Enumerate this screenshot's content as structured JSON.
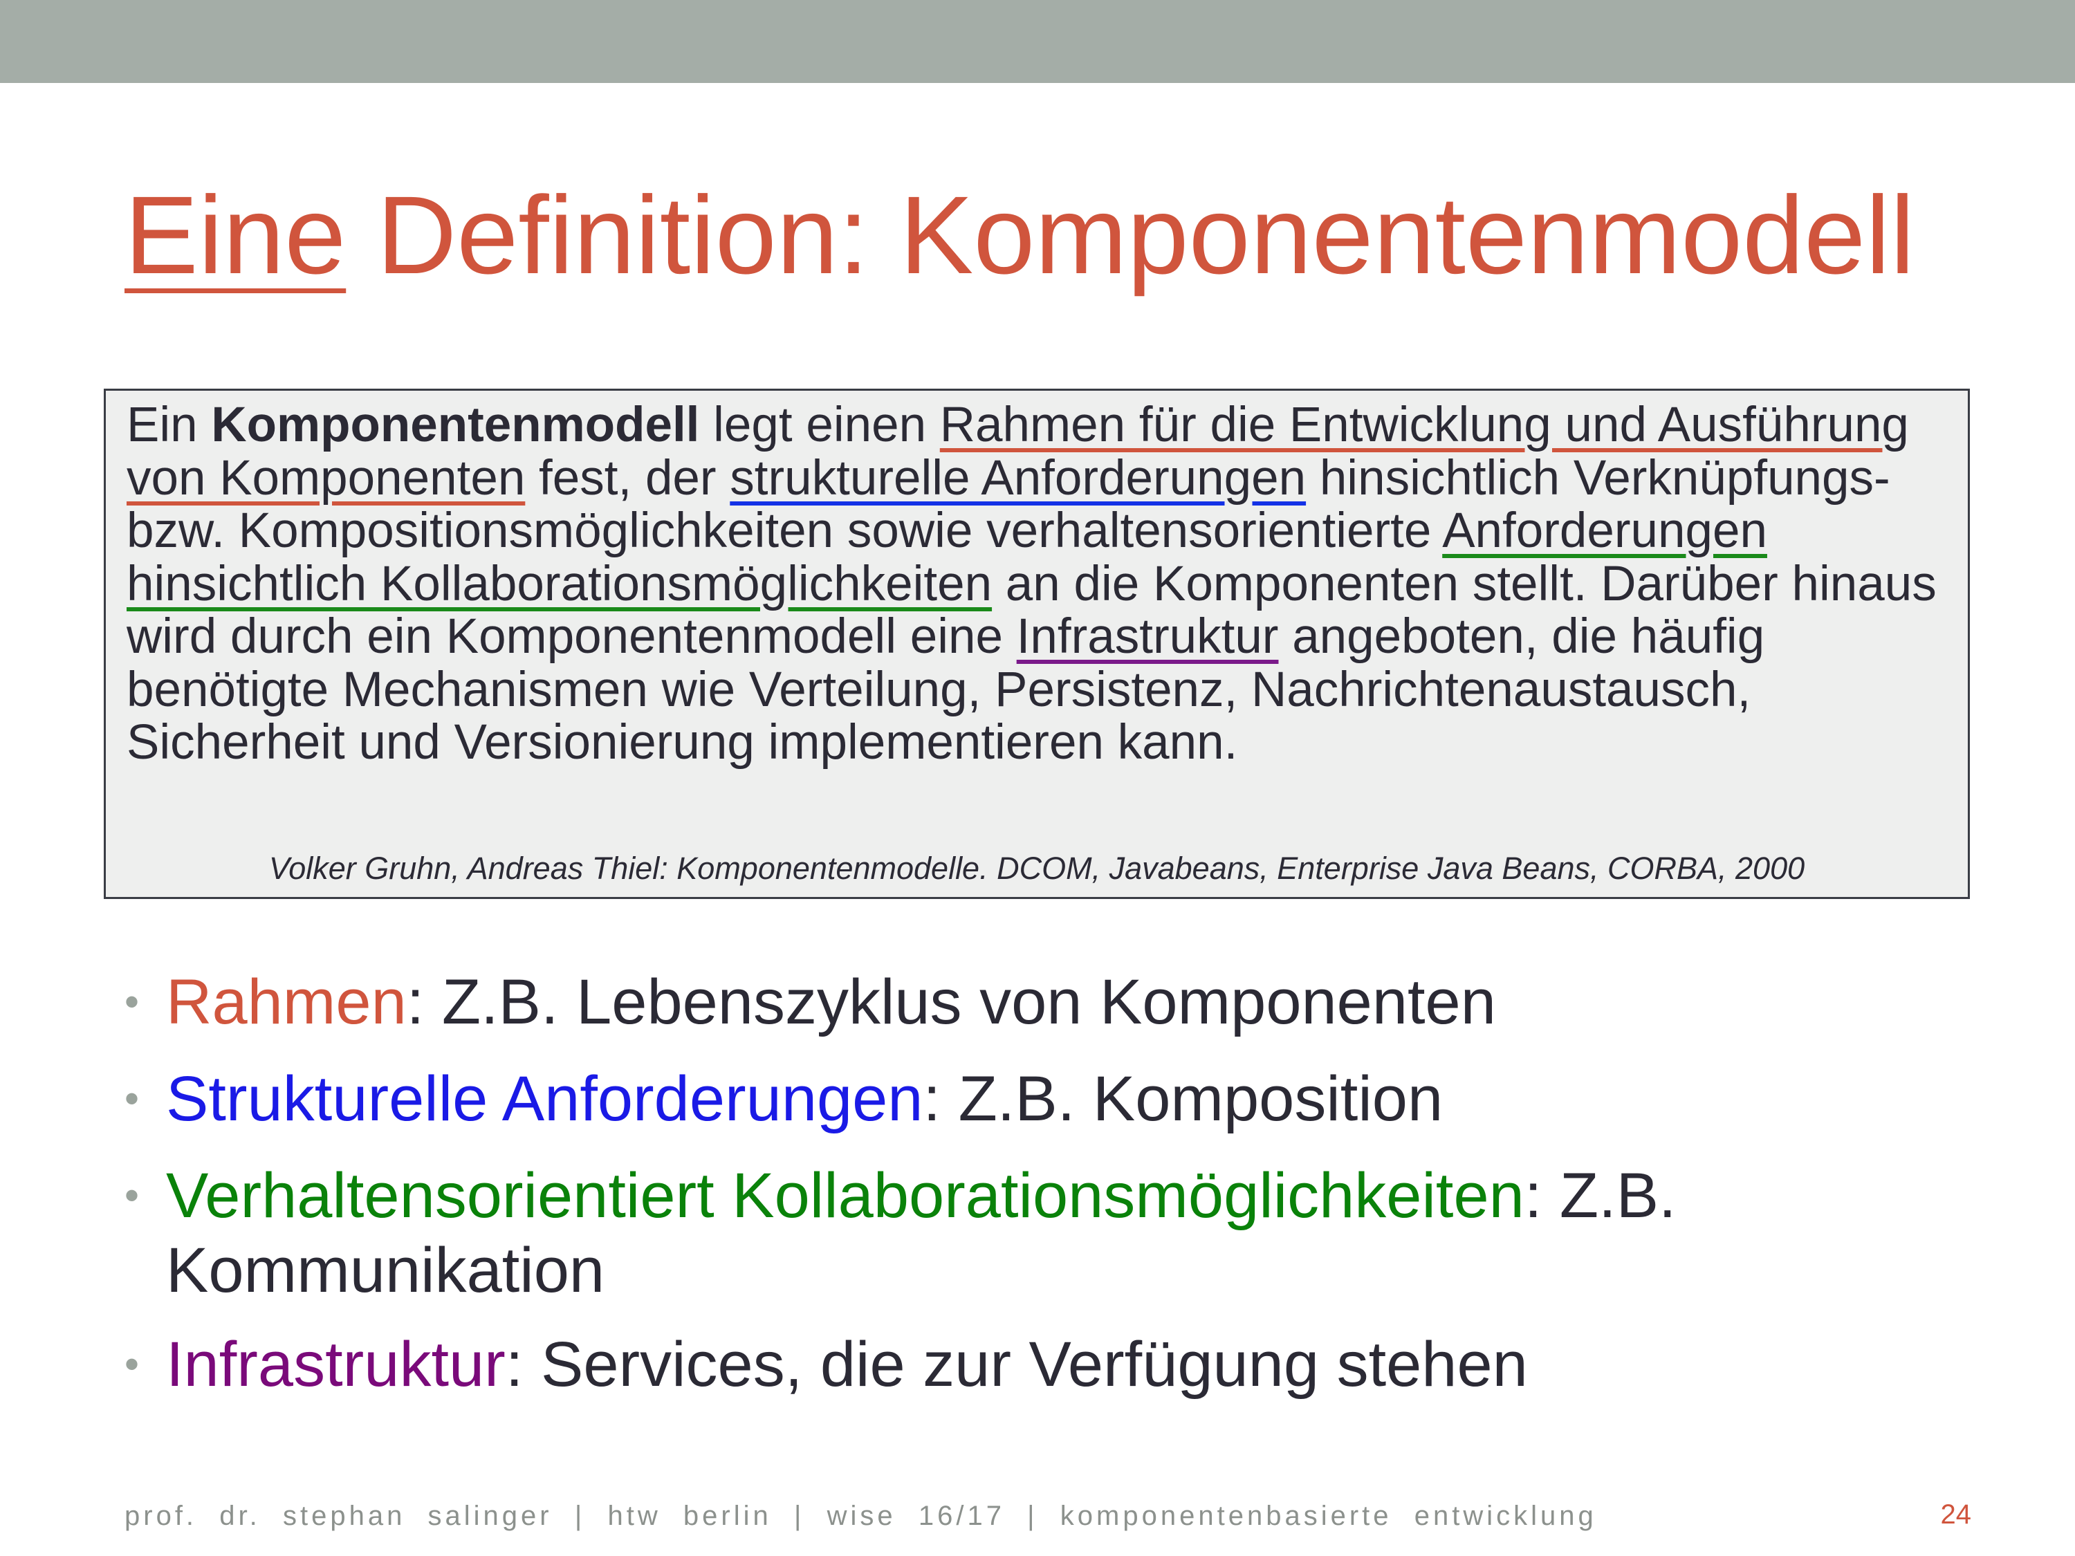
{
  "title": {
    "underlined": "Eine",
    "rest": " Definition: Komponentenmodell"
  },
  "definition": {
    "t1": "Ein ",
    "bold": "Komponentenmodell",
    "t2": " legt einen ",
    "red": "Rahmen für die Entwicklung und Ausführung von Komponenten",
    "t3": " fest, der ",
    "blue": "strukturelle Anforderungen",
    "t4": " hinsichtlich Verknüpfungs- bzw. Kompositionsmöglichkeiten sowie verhaltensorientierte ",
    "green": "Anforderungen hinsichtlich Kollaborationsmöglichkeiten",
    "t5": " an die Komponenten stellt. Darüber hinaus wird durch ein Komponentenmodell eine ",
    "purple": "Infrastruktur",
    "t6": " angeboten, die häufig benötigte Mechanismen wie Verteilung, Persistenz, Nachrichtenaustausch, Sicherheit und Versionierung implementieren kann.",
    "citation": "Volker Gruhn, Andreas Thiel: Komponentenmodelle. DCOM, Javabeans, Enterprise Java Beans, CORBA, 2000"
  },
  "bullets": [
    {
      "term": "Rahmen",
      "text": ": Z.B. Lebenszyklus von Komponenten"
    },
    {
      "term": "Strukturelle Anforderungen",
      "text": ": Z.B. Komposition"
    },
    {
      "term": "Verhaltensorientiert Kollaborationsmöglichkeiten",
      "text": ": Z.B. Kommunikation"
    },
    {
      "term": "Infrastruktur",
      "text": ": Services, die zur Verfügung stehen"
    }
  ],
  "bullet_symbol": "•",
  "footer": "prof.  dr.  stephan  salinger  |  htw  berlin  |  wise  16/17  |  komponentenbasierte  entwicklung",
  "page_number": "24",
  "colors": {
    "accent": "#d0553d",
    "blue": "#1a1ae6",
    "green": "#0a820a",
    "purple": "#7a0a7a",
    "top_bar": "#a4ada7"
  }
}
